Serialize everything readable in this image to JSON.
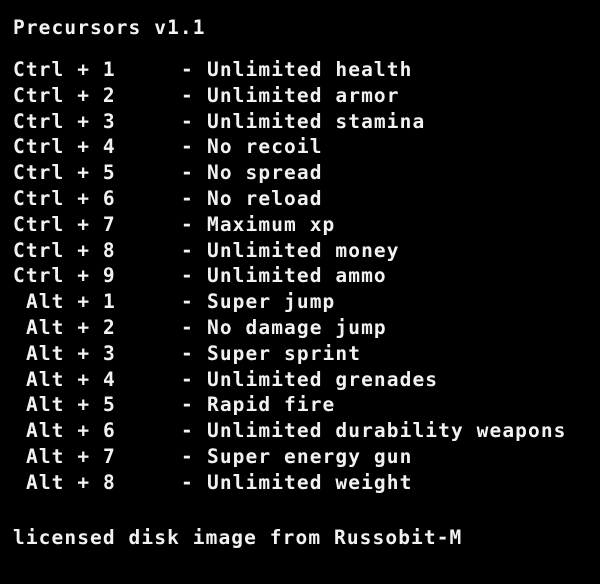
{
  "title": "Precursors v1.1",
  "separator": "-",
  "hotkeys": [
    {
      "key": "Ctrl + 1",
      "modifier": "ctrl",
      "action": "Unlimited health"
    },
    {
      "key": "Ctrl + 2",
      "modifier": "ctrl",
      "action": "Unlimited armor"
    },
    {
      "key": "Ctrl + 3",
      "modifier": "ctrl",
      "action": "Unlimited stamina"
    },
    {
      "key": "Ctrl + 4",
      "modifier": "ctrl",
      "action": "No recoil"
    },
    {
      "key": "Ctrl + 5",
      "modifier": "ctrl",
      "action": "No spread"
    },
    {
      "key": "Ctrl + 6",
      "modifier": "ctrl",
      "action": "No reload"
    },
    {
      "key": "Ctrl + 7",
      "modifier": "ctrl",
      "action": "Maximum xp"
    },
    {
      "key": "Ctrl + 8",
      "modifier": "ctrl",
      "action": "Unlimited money"
    },
    {
      "key": "Ctrl + 9",
      "modifier": "ctrl",
      "action": "Unlimited ammo"
    },
    {
      "key": "Alt + 1",
      "modifier": "alt",
      "action": "Super jump"
    },
    {
      "key": "Alt + 2",
      "modifier": "alt",
      "action": "No damage jump"
    },
    {
      "key": "Alt + 3",
      "modifier": "alt",
      "action": "Super sprint"
    },
    {
      "key": "Alt + 4",
      "modifier": "alt",
      "action": "Unlimited grenades"
    },
    {
      "key": "Alt + 5",
      "modifier": "alt",
      "action": "Rapid fire"
    },
    {
      "key": "Alt + 6",
      "modifier": "alt",
      "action": "Unlimited durability weapons"
    },
    {
      "key": "Alt + 7",
      "modifier": "alt",
      "action": "Super energy gun"
    },
    {
      "key": "Alt + 8",
      "modifier": "alt",
      "action": "Unlimited weight"
    }
  ],
  "footer": "licensed disk image from Russobit-M",
  "colors": {
    "background": "#000000",
    "text": "#f2f2f2"
  }
}
